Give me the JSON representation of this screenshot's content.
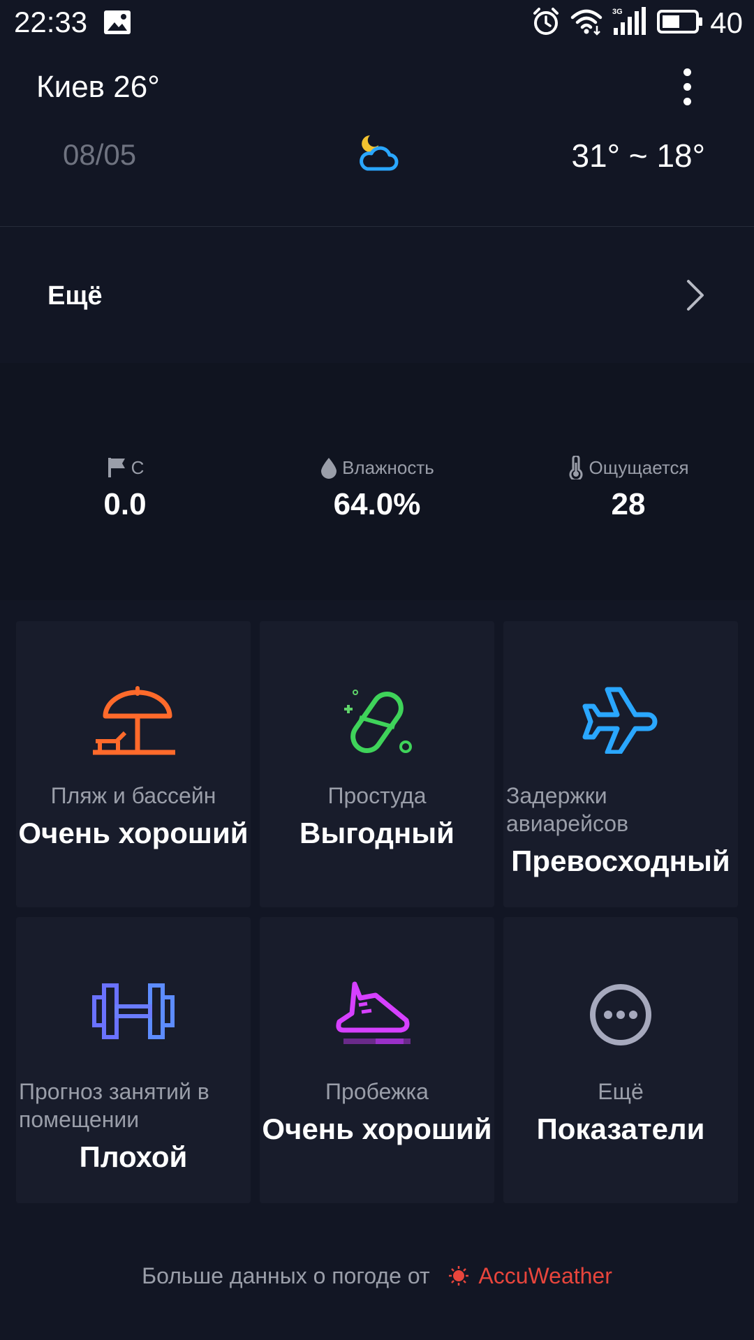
{
  "status_bar": {
    "time": "22:33",
    "battery_text": "40",
    "icons": [
      "gallery-icon",
      "alarm-icon",
      "wifi-icon",
      "signal-3g-icon",
      "battery-icon"
    ]
  },
  "header": {
    "city_temp": "Киев 26°",
    "menu_icon": "kebab-icon"
  },
  "forecast_day": {
    "date": "08/05",
    "icon": "partly-cloudy-night-icon",
    "range": "31° ~ 18°"
  },
  "more_row": {
    "label": "Ещё",
    "icon": "chevron-right-icon"
  },
  "metrics": [
    {
      "label": "С",
      "value": "0.0",
      "icon": "flag-icon"
    },
    {
      "label": "Влажность",
      "value": "64.0%",
      "icon": "droplet-icon"
    },
    {
      "label": "Ощущается",
      "value": "28",
      "icon": "thermometer-icon"
    }
  ],
  "tiles": [
    {
      "label": "Пляж и бассейн",
      "value": "Очень хороший",
      "icon": "beach-umbrella-icon",
      "color": "#ff6a2b"
    },
    {
      "label": "Простуда",
      "value": "Выгодный",
      "icon": "pill-icon",
      "color": "#3fd35a"
    },
    {
      "label_line1": "Задержки",
      "label_line2": "авиарейсов",
      "value": "Превосходный",
      "icon": "airplane-icon",
      "color": "#2aa7ff"
    },
    {
      "label_line1": "Прогноз занятий в",
      "label_line2": "помещении",
      "value": "Плохой",
      "icon": "dumbbell-icon",
      "color": "#6a72ff"
    },
    {
      "label": "Пробежка",
      "value": "Очень хороший",
      "icon": "sneaker-icon",
      "color": "#d640ff"
    },
    {
      "label": "Ещё",
      "value": "Показатели",
      "icon": "more-dots-icon",
      "color": "#a6a9bd"
    }
  ],
  "footer": {
    "text": "Больше данных о погоде от",
    "brand": "AccuWeather",
    "brand_color": "#e8453c"
  }
}
